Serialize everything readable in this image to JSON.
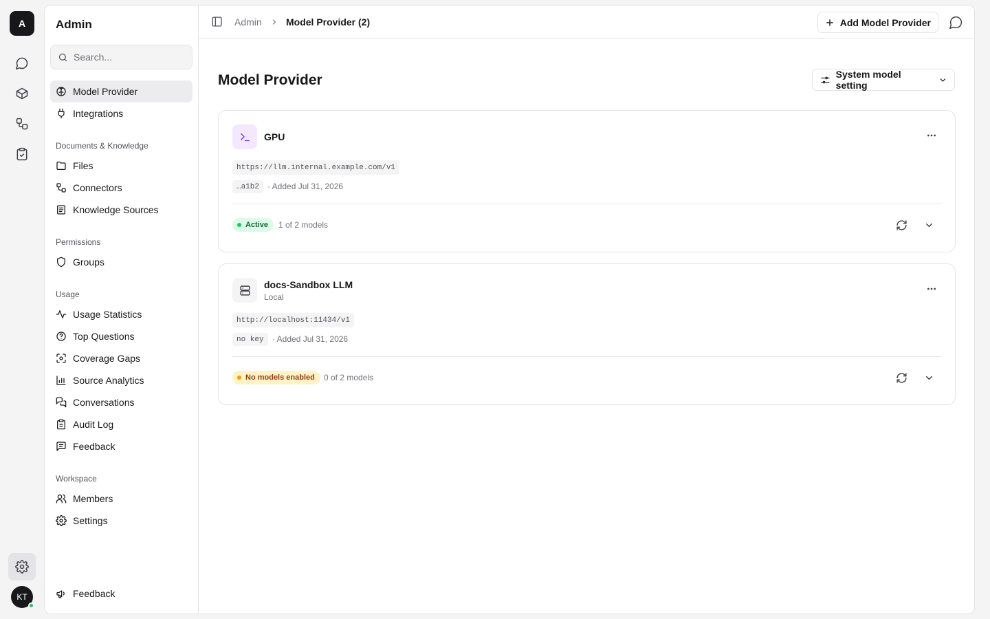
{
  "rail": {
    "logo": "A",
    "items": [
      {
        "name": "chat",
        "icon": "message-circle-icon"
      },
      {
        "name": "models",
        "icon": "box-icon"
      },
      {
        "name": "workflows",
        "icon": "workflow-icon"
      },
      {
        "name": "tasks",
        "icon": "clipboard-check-icon"
      }
    ],
    "settings_icon": "gear-icon",
    "avatar_initials": "KT",
    "status_color": "#22c55e"
  },
  "sidebar": {
    "title": "Admin",
    "search_placeholder": "Search...",
    "top_items": [
      {
        "label": "Model Provider",
        "icon": "brain-icon",
        "active": true
      },
      {
        "label": "Integrations",
        "icon": "plug-icon"
      }
    ],
    "sections": [
      {
        "title": "Documents & Knowledge",
        "items": [
          {
            "label": "Files",
            "icon": "folder-icon"
          },
          {
            "label": "Connectors",
            "icon": "connectors-icon"
          },
          {
            "label": "Knowledge Sources",
            "icon": "book-icon"
          }
        ]
      },
      {
        "title": "Permissions",
        "items": [
          {
            "label": "Groups",
            "icon": "shield-icon"
          }
        ]
      },
      {
        "title": "Usage",
        "items": [
          {
            "label": "Usage Statistics",
            "icon": "activity-icon"
          },
          {
            "label": "Top Questions",
            "icon": "help-circle-icon"
          },
          {
            "label": "Coverage Gaps",
            "icon": "scan-icon"
          },
          {
            "label": "Source Analytics",
            "icon": "bar-chart-icon"
          },
          {
            "label": "Conversations",
            "icon": "messages-icon"
          },
          {
            "label": "Audit Log",
            "icon": "clipboard-list-icon"
          },
          {
            "label": "Feedback",
            "icon": "message-square-text-icon"
          }
        ]
      },
      {
        "title": "Workspace",
        "items": [
          {
            "label": "Members",
            "icon": "users-icon"
          },
          {
            "label": "Settings",
            "icon": "gear-icon"
          }
        ]
      }
    ],
    "footer_item": {
      "label": "Feedback",
      "icon": "megaphone-icon"
    }
  },
  "topbar": {
    "breadcrumb": [
      "Admin",
      "Model Provider (2)"
    ],
    "add_button": "Add Model Provider"
  },
  "page": {
    "title": "Model Provider",
    "system_setting_button": "System model setting"
  },
  "providers": [
    {
      "name": "GPU",
      "subtitle": "",
      "icon": "terminal-icon",
      "url": "https://llm.internal.example.com/v1",
      "key": "…a1b2",
      "added": "· Added Jul 31, 2026",
      "status": "Active",
      "models": "1 of 2 models"
    },
    {
      "name": "docs-Sandbox LLM",
      "subtitle": "Local",
      "icon": "server-icon",
      "url": "http://localhost:11434/v1",
      "key": "no key",
      "added": "· Added Jul 31, 2026",
      "status": "No models enabled",
      "models": "0 of 2 models"
    }
  ],
  "colors": {
    "active_badge_bg": "#dcfce7",
    "active_badge_text": "#166534",
    "warning_badge_bg": "#fef3c7",
    "warning_badge_text": "#92400e"
  }
}
